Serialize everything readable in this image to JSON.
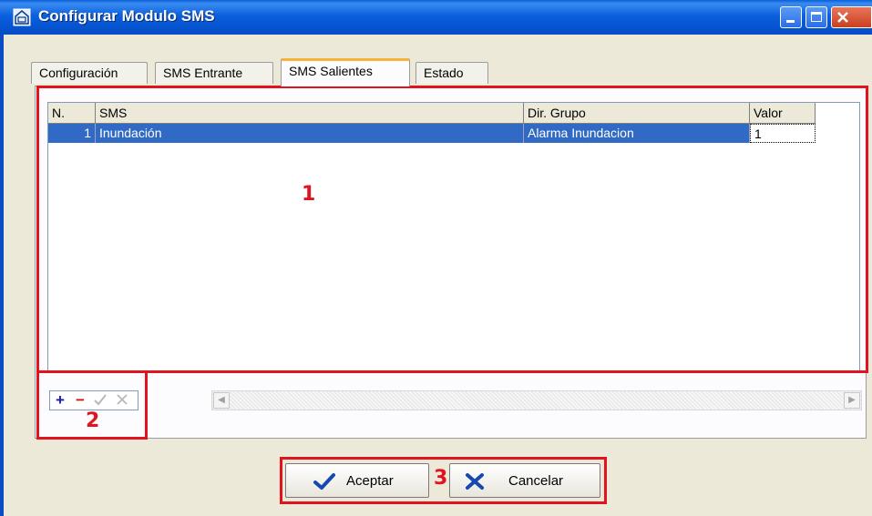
{
  "window": {
    "title": "Configurar Modulo SMS"
  },
  "tabs": [
    {
      "label": "Configuración",
      "active": false
    },
    {
      "label": "SMS Entrante",
      "active": false
    },
    {
      "label": "SMS Salientes",
      "active": true
    },
    {
      "label": "Estado",
      "active": false
    }
  ],
  "grid": {
    "columns": [
      "N.",
      "SMS",
      "Dir. Grupo",
      "Valor"
    ],
    "rows": [
      {
        "n": "1",
        "sms": "Inundación",
        "grupo": "Alarma Inundacion",
        "valor": "1"
      }
    ]
  },
  "navigator": {
    "buttons": [
      "add-icon",
      "delete-icon",
      "post-icon",
      "cancel-edit-icon"
    ]
  },
  "annotations": {
    "label1": "1",
    "label2": "2",
    "label3": "3"
  },
  "buttons": {
    "accept": "Aceptar",
    "cancel": "Cancelar"
  },
  "colors": {
    "selection": "#316ac5",
    "annotation_red": "#e0141e",
    "titlebar": "#0553d0"
  }
}
